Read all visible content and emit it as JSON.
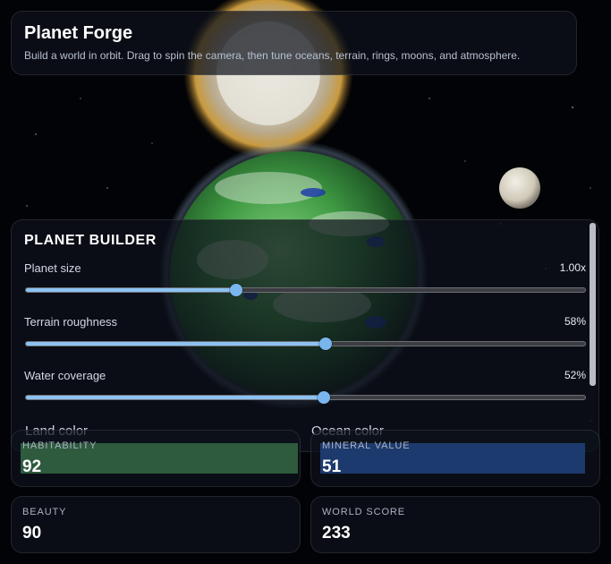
{
  "header": {
    "title": "Planet Forge",
    "subtitle": "Build a world in orbit. Drag to spin the camera, then tune oceans, terrain, rings, moons, and atmosphere."
  },
  "builder": {
    "title": "PLANET BUILDER",
    "controls": [
      {
        "label": "Planet size",
        "value_text": "1.00x",
        "fraction": 0.376
      },
      {
        "label": "Terrain roughness",
        "value_text": "58%",
        "fraction": 0.536
      },
      {
        "label": "Water coverage",
        "value_text": "52%",
        "fraction": 0.533
      }
    ],
    "land_color_label": "Land color",
    "ocean_color_label": "Ocean color",
    "land_color": "#2e5a3e",
    "ocean_color": "#1d3a6e"
  },
  "stats": {
    "habitability": {
      "label": "HABITABILITY",
      "value": "92"
    },
    "mineral": {
      "label": "MINERAL VALUE",
      "value": "51"
    },
    "beauty": {
      "label": "BEAUTY",
      "value": "90"
    },
    "score": {
      "label": "WORLD SCORE",
      "value": "233"
    }
  },
  "colors": {
    "slider_fill": "#8cc2f2",
    "slider_thumb": "#7ab6ee",
    "planet_land": "#3f9a43",
    "planet_ocean": "#1f3ea8",
    "sun_halo": "#c99a3e"
  }
}
